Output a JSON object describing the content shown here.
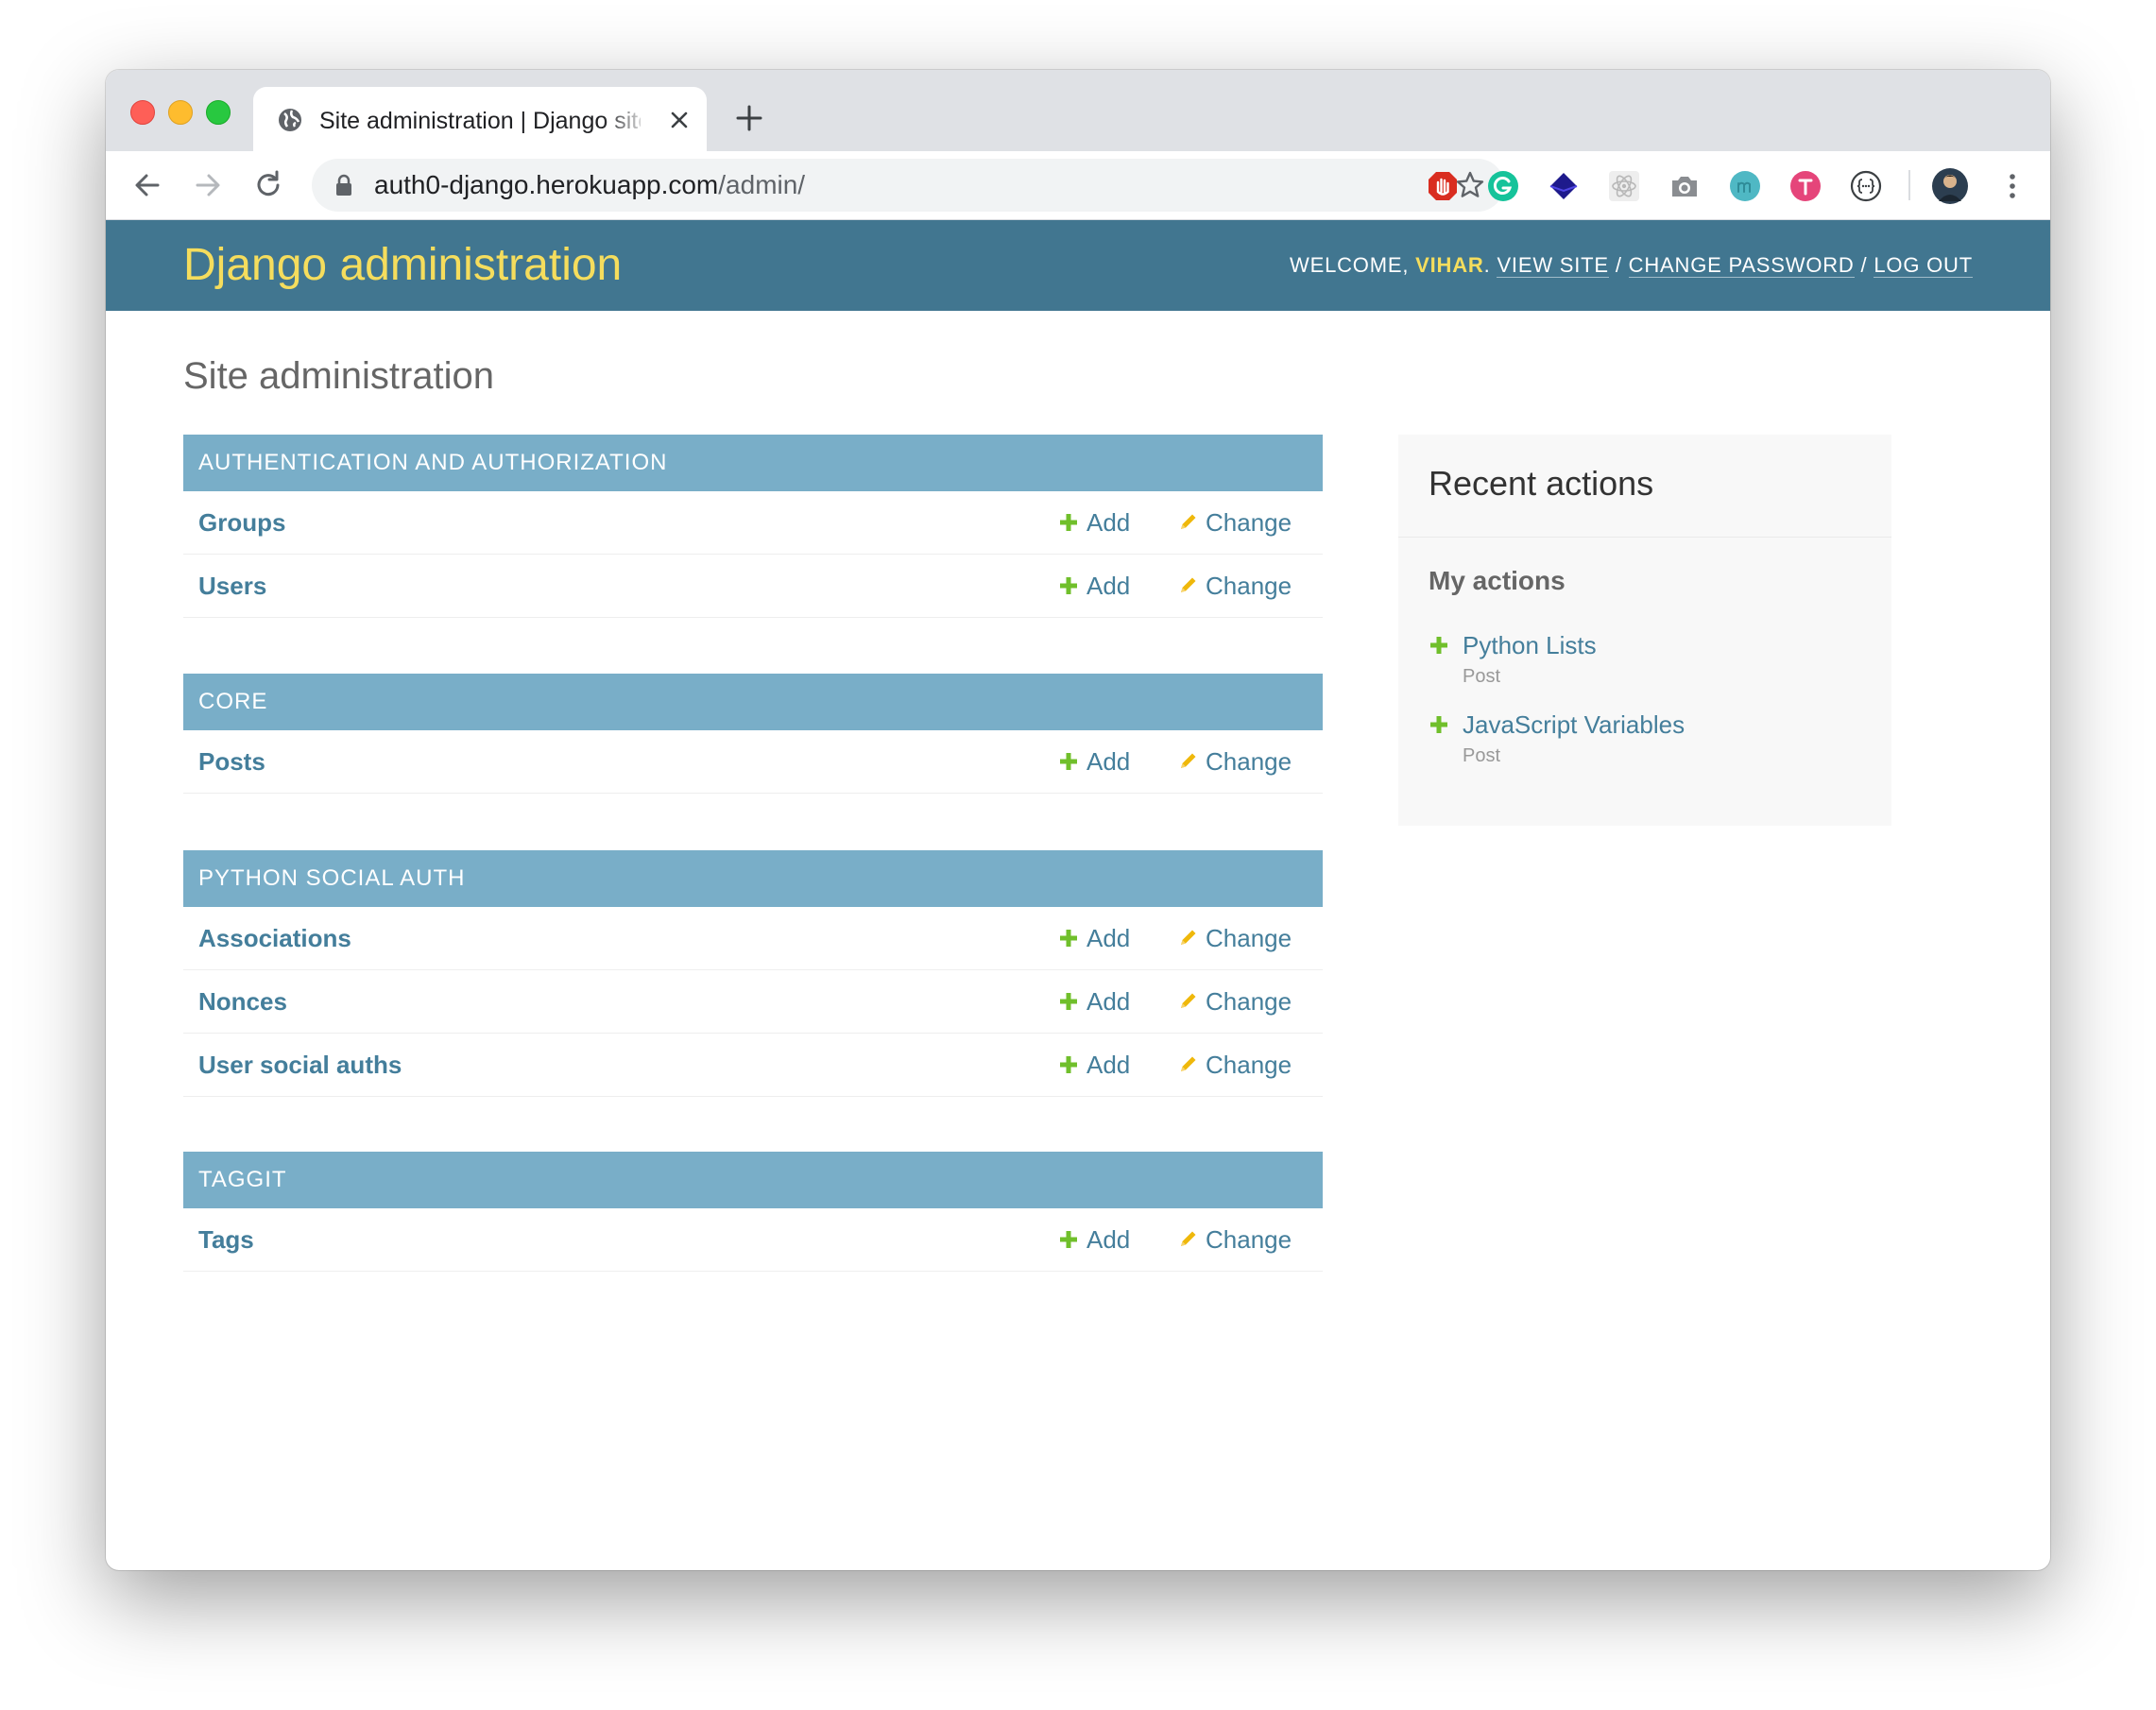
{
  "browser": {
    "tab_title": "Site administration | Django site admin",
    "url_host": "auth0-django.herokuapp.com",
    "url_path": "/admin/",
    "extensions": [
      "ublock-icon",
      "grammarly-icon",
      "dark-diamond-icon",
      "react-devtools-icon",
      "screenshot-camera-icon",
      "mercury-reader-icon",
      "toggl-icon",
      "json-viewer-icon",
      "profile-avatar"
    ]
  },
  "header": {
    "branding": "Django administration",
    "welcome": "WELCOME,",
    "username": "VIHAR",
    "view_site": "VIEW SITE",
    "change_password": "CHANGE PASSWORD",
    "log_out": "LOG OUT",
    "separator": "/"
  },
  "page_title": "Site administration",
  "action_labels": {
    "add": "Add",
    "change": "Change"
  },
  "modules": [
    {
      "caption": "AUTHENTICATION AND AUTHORIZATION",
      "models": [
        "Groups",
        "Users"
      ]
    },
    {
      "caption": "CORE",
      "models": [
        "Posts"
      ]
    },
    {
      "caption": "PYTHON SOCIAL AUTH",
      "models": [
        "Associations",
        "Nonces",
        "User social auths"
      ]
    },
    {
      "caption": "TAGGIT",
      "models": [
        "Tags"
      ]
    }
  ],
  "recent_actions": {
    "title": "Recent actions",
    "subtitle": "My actions",
    "items": [
      {
        "label": "Python Lists",
        "type": "Post"
      },
      {
        "label": "JavaScript Variables",
        "type": "Post"
      }
    ]
  },
  "colors": {
    "header_bg": "#417690",
    "branding": "#f5dd5d",
    "caption_bg": "#79aec8",
    "link": "#447e9b",
    "add_icon": "#70bf2b",
    "change_icon": "#efb80b"
  }
}
